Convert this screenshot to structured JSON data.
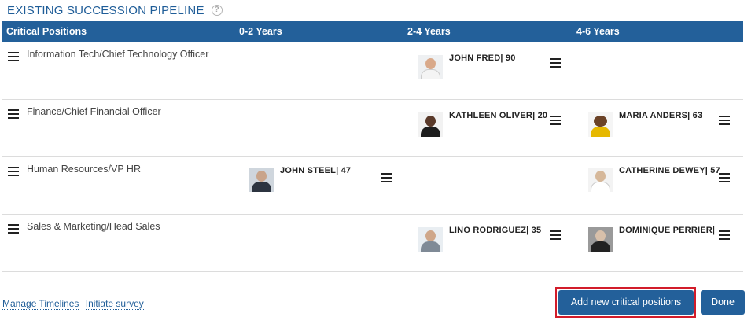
{
  "header": {
    "title": "EXISTING SUCCESSION PIPELINE",
    "help_glyph": "?"
  },
  "table": {
    "columns": [
      "Critical Positions",
      "0-2 Years",
      "2-4 Years",
      "4-6 Years"
    ],
    "rows": [
      {
        "position": "Information Tech/Chief Technology Officer",
        "candidates": {
          "0-2": "",
          "2-4": "JOHN FRED| 90",
          "4-6": ""
        }
      },
      {
        "position": "Finance/Chief Financial Officer",
        "candidates": {
          "0-2": "",
          "2-4": "KATHLEEN OLIVER| 20",
          "4-6": "MARIA ANDERS| 63"
        }
      },
      {
        "position": "Human Resources/VP HR",
        "candidates": {
          "0-2": "JOHN STEEL| 47",
          "2-4": "",
          "4-6": "CATHERINE DEWEY| 57"
        }
      },
      {
        "position": "Sales & Marketing/Head Sales",
        "candidates": {
          "0-2": "",
          "2-4": "LINO RODRIGUEZ| 35",
          "4-6": "DOMINIQUE PERRIER|"
        }
      }
    ]
  },
  "footer": {
    "links": [
      "Manage Timelines",
      "Initiate survey"
    ],
    "add_button": "Add new critical positions",
    "done_button": "Done"
  },
  "colors": {
    "accent": "#23609a",
    "title": "#1f5d98",
    "highlight_outline": "#d21c2a"
  },
  "icons": {
    "row_handle": "hamburger-icon",
    "candidate_menu": "hamburger-icon",
    "help": "help-circle-icon"
  }
}
